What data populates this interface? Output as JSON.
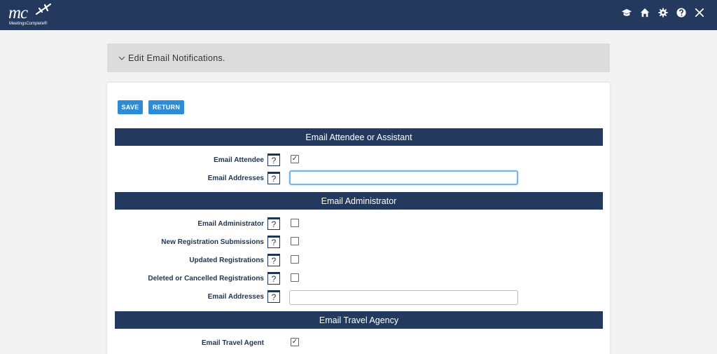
{
  "app": {
    "logo_text": "mc",
    "logo_subtitle": "MeetingsComplete®"
  },
  "header_icons": [
    "graduation-cap-icon",
    "home-icon",
    "gear-icon",
    "question-icon",
    "close-icon"
  ],
  "collapse": {
    "title": "Edit Email Notifications."
  },
  "toolbar": {
    "save_label": "SAVE",
    "return_label": "RETURN"
  },
  "sections": [
    {
      "title": "Email Attendee or Assistant",
      "rows": [
        {
          "label": "Email Attendee",
          "type": "checkbox",
          "checked": true
        },
        {
          "label": "Email Addresses",
          "type": "text",
          "value": ""
        }
      ]
    },
    {
      "title": "Email Administrator",
      "rows": [
        {
          "label": "Email Administrator",
          "type": "checkbox",
          "checked": false
        },
        {
          "label": "New Registration Submissions",
          "type": "checkbox",
          "checked": false
        },
        {
          "label": "Updated Registrations",
          "type": "checkbox",
          "checked": false
        },
        {
          "label": "Deleted or Cancelled Registrations",
          "type": "checkbox",
          "checked": false
        },
        {
          "label": "Email Addresses",
          "type": "text",
          "value": ""
        }
      ]
    },
    {
      "title": "Email Travel Agency",
      "rows": [
        {
          "label": "Email Travel Agent",
          "type": "checkbox",
          "checked": true
        }
      ]
    }
  ],
  "help_glyph": "?",
  "check_glyph": "✓",
  "colors": {
    "header_bg": "#233a5e",
    "button_bg": "#2e8bd6",
    "page_bg": "#f3f3f3"
  }
}
